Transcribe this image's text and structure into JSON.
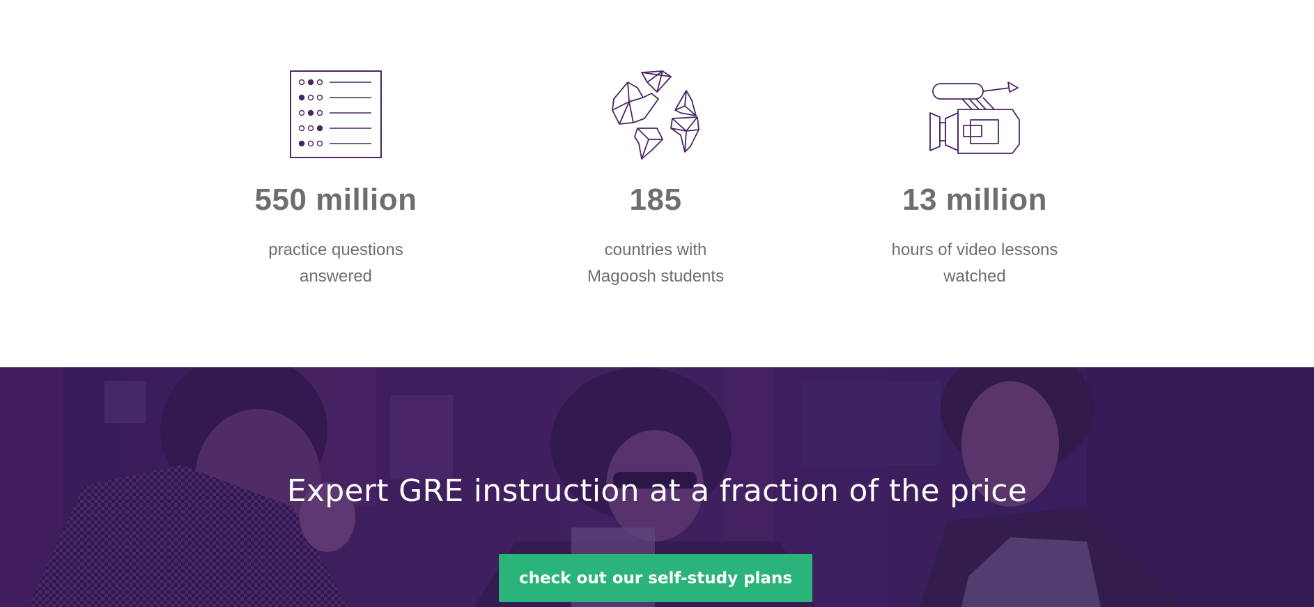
{
  "stats": [
    {
      "icon": "checklist-icon",
      "number": "550 million",
      "description_lines": [
        "practice questions",
        "answered"
      ]
    },
    {
      "icon": "world-map-icon",
      "number": "185",
      "description_lines": [
        "countries with",
        "Magoosh students"
      ]
    },
    {
      "icon": "video-camera-icon",
      "number": "13 million",
      "description_lines": [
        "hours of video lessons",
        "watched"
      ]
    }
  ],
  "hero": {
    "title": "Expert GRE instruction at a fraction of the price",
    "cta_label": "check out our self-study plans"
  },
  "colors": {
    "icon_purple": "#4a2563",
    "stat_text": "#6d6e73",
    "hero_overlay": "#3b1d5c",
    "cta_green": "#2bb479"
  }
}
